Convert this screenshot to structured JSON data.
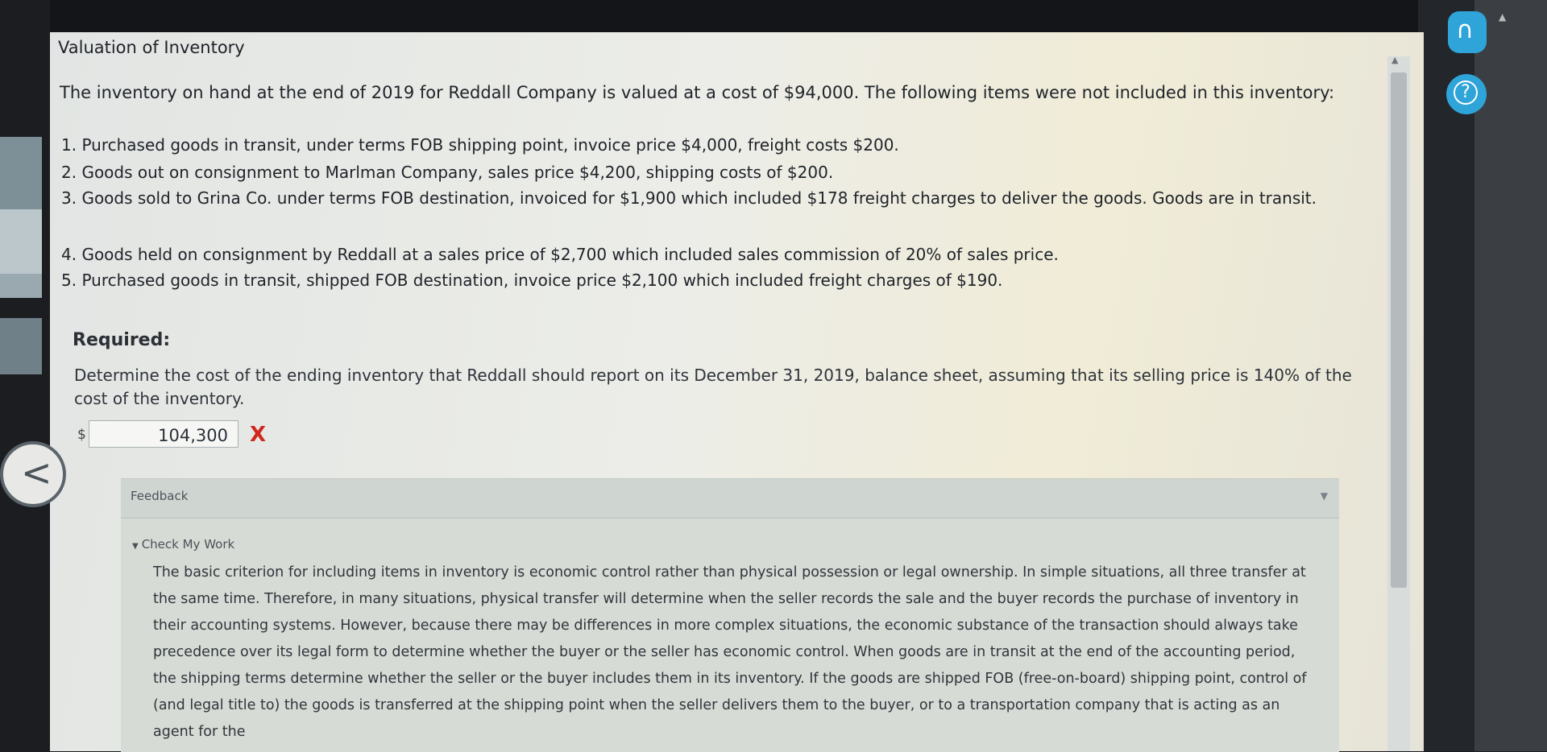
{
  "page": {
    "title": "Valuation of Inventory",
    "intro": "The inventory on hand at the end of 2019 for Reddall Company is valued at a cost of $94,000. The following items were not included in this inventory:"
  },
  "items": [
    "1. Purchased goods in transit, under terms FOB shipping point, invoice price $4,000, freight costs $200.",
    "2. Goods out on consignment to Marlman Company, sales price $4,200, shipping costs of $200.",
    "3. Goods sold to Grina Co. under terms FOB destination, invoiced for $1,900 which included $178 freight charges to deliver the goods. Goods are in transit.",
    "4. Goods held on consignment by Reddall at a sales price of $2,700 which included sales commission of 20% of sales price.",
    "5. Purchased goods in transit, shipped FOB destination, invoice price $2,100 which included freight charges of $190."
  ],
  "required": {
    "label": "Required:",
    "question": "Determine the cost of the ending inventory that Reddall should report on its December 31, 2019, balance sheet, assuming that its selling price is 140% of the cost of the inventory.",
    "currency": "$",
    "answer_value": "104,300",
    "wrong_mark": "X"
  },
  "feedback": {
    "label": "Feedback",
    "check_label": "Check My Work",
    "explanation": "The basic criterion for including items in inventory is economic control rather than physical possession or legal ownership. In simple situations, all three transfer at the same time. Therefore, in many situations, physical transfer will determine when the seller records the sale and the buyer records the purchase of inventory in their accounting systems. However, because there may be differences in more complex situations, the economic substance of the transaction should always take precedence over its legal form to determine whether the buyer or the seller has economic control. When goods are in transit at the end of the accounting period, the shipping terms determine whether the seller or the buyer includes them in its inventory. If the goods are shipped FOB (free-on-board) shipping point, control of (and legal title to) the goods is transferred at the shipping point when the seller delivers them to the buyer, or to a transportation company that is acting as an agent for the"
  },
  "icons": {
    "headset": "headset-icon",
    "help": "help-icon",
    "back": "chevron-left-icon",
    "wrong": "x-mark-icon"
  },
  "colors": {
    "accent": "#2fa4d9",
    "error": "#d0281f"
  }
}
